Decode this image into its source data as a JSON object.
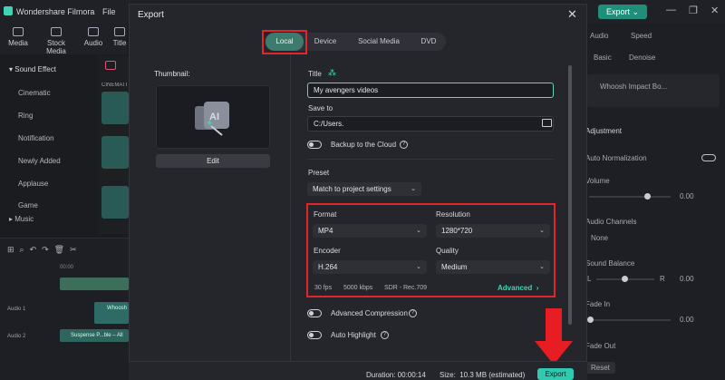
{
  "app": {
    "title": "Wondershare Filmora",
    "menu_file": "File",
    "export_label": "Export",
    "export_caret": "⌄",
    "toolbar": [
      "Media",
      "Stock Media",
      "Audio",
      "Title"
    ]
  },
  "sidebar": {
    "section": "Sound Effect",
    "items": [
      "Cinematic",
      "Ring",
      "Notification",
      "Newly Added",
      "Applause",
      "Game"
    ],
    "music": "Music",
    "category_label": "CINEMATI"
  },
  "timeline": {
    "track_audio1": "Audio 1",
    "track_audio2": "Audio 2",
    "timecode": "00:00",
    "clip1": "Whoosh",
    "clip2": "Suspense P...ble – All"
  },
  "right_panel": {
    "tabs": [
      "Audio",
      "Speed"
    ],
    "subtabs": [
      "Basic",
      "Denoise"
    ],
    "audio_item": "Whoosh Impact Bo...",
    "adjustment": "Adjustment",
    "auto_normalization": "Auto Normalization",
    "volume": "Volume",
    "volume_value": "0.00",
    "audio_channels": "Audio Channels",
    "channels_value": "None",
    "sound_balance": "Sound Balance",
    "balance_l": "L",
    "balance_r": "R",
    "balance_value": "0.00",
    "fade_in": "Fade In",
    "fade_in_value": "0.00",
    "fade_out": "Fade Out",
    "reset": "Reset"
  },
  "dialog": {
    "title": "Export",
    "tabs": [
      "Local",
      "Device",
      "Social Media",
      "DVD"
    ],
    "active_tab": "Local",
    "thumbnail_label": "Thumbnail:",
    "edit_label": "Edit",
    "title_label": "Title",
    "title_value": "My avengers videos",
    "save_to_label": "Save to",
    "save_to_value": "C:/Users.",
    "backup_label": "Backup to the Cloud",
    "preset_label": "Preset",
    "preset_value": "Match to project settings",
    "format_label": "Format",
    "format_value": "MP4",
    "resolution_label": "Resolution",
    "resolution_value": "1280*720",
    "encoder_label": "Encoder",
    "encoder_value": "H.264",
    "quality_label": "Quality",
    "quality_value": "Medium",
    "fps": "30 fps",
    "bitrate": "5000 kbps",
    "color": "SDR - Rec.709",
    "advanced_label": "Advanced",
    "advanced_compression": "Advanced Compression",
    "auto_highlight": "Auto Highlight",
    "duration": "Duration: 00:00:14",
    "size": "Size:  10.3 MB (estimated)",
    "export_label": "Export"
  },
  "colors": {
    "accent": "#2fcab0",
    "annotation_red": "#e0252b"
  }
}
